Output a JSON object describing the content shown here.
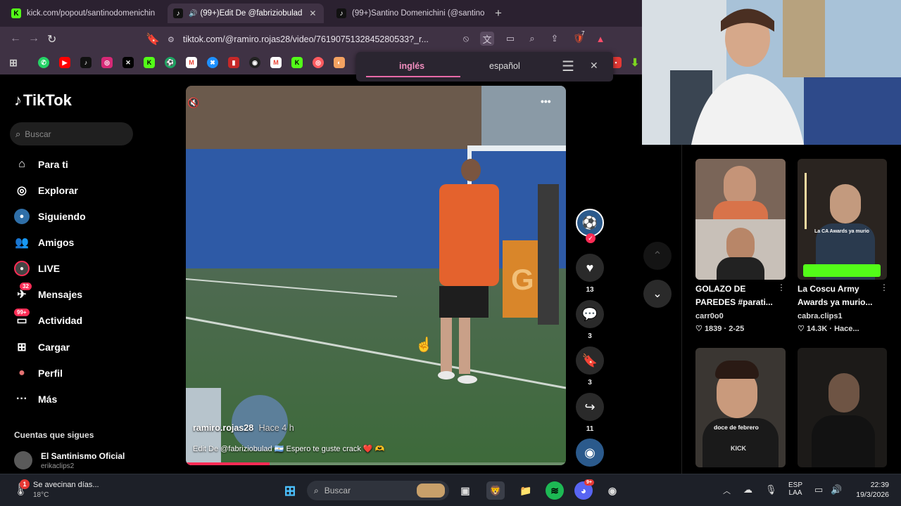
{
  "browser": {
    "tabs": [
      {
        "label": "kick.com/popout/santinodomenichin",
        "favicon": "K"
      },
      {
        "label": "(99+)Edit De @fabriziobulad",
        "favicon": "tiktok-icon"
      },
      {
        "label": "(99+)Santino Domenichini (@santino",
        "favicon": "tiktok-icon"
      }
    ],
    "new_tab_label": "+",
    "url": "tiktok.com/@ramiro.rojas28/video/7619075132845280533?_r...",
    "shield_count": "7"
  },
  "translate_popup": {
    "lang_active": "inglés",
    "lang_other": "español"
  },
  "tiktok": {
    "logo": "TikTok",
    "search_placeholder": "Buscar",
    "nav": [
      {
        "label": "Para ti",
        "icon": "home-icon"
      },
      {
        "label": "Explorar",
        "icon": "compass-icon"
      },
      {
        "label": "Siguiendo",
        "icon": "following-avatar-icon"
      },
      {
        "label": "Amigos",
        "icon": "friends-icon"
      },
      {
        "label": "LIVE",
        "icon": "live-icon"
      },
      {
        "label": "Mensajes",
        "icon": "messages-icon",
        "badge": "32"
      },
      {
        "label": "Actividad",
        "icon": "activity-icon",
        "badge": "99+"
      },
      {
        "label": "Cargar",
        "icon": "upload-icon"
      },
      {
        "label": "Perfil",
        "icon": "profile-icon"
      },
      {
        "label": "Más",
        "icon": "more-icon"
      }
    ],
    "following_header": "Cuentas que sigues",
    "following_accounts": [
      {
        "name": "El Santinismo Oficial",
        "handle": "erikaclips2"
      }
    ]
  },
  "video": {
    "author": "ramiro.rojas28",
    "time_ago": "Hace 4 h",
    "caption": "Edit De @fabriziobulad 🇦🇷 Espero te guste crack ❤️ 🫶",
    "progress": 0.22,
    "more_label": "•••"
  },
  "actions": {
    "likes": "13",
    "comments": "3",
    "saves": "3",
    "shares": "11"
  },
  "recommended": [
    {
      "title_line1": "GOLAZO DE",
      "title_line2": "PAREDES #parati...",
      "author": "carr0o0",
      "likes": "1839",
      "date": "2-25"
    },
    {
      "title_line1": "La Coscu Army",
      "title_line2": "Awards ya murio...",
      "author": "cabra.clips1",
      "likes": "14.3K",
      "date": "Hace..."
    },
    {
      "overlay_text": "doce de febrero"
    },
    {
      "overlay_text": ""
    }
  ],
  "thumb_texts": {
    "coscu_overlay": "La CA Awards ya murio",
    "kick_overlay": "KICK"
  },
  "taskbar": {
    "weather_title": "Se avecinan días...",
    "weather_temp": "18°C",
    "weather_badge": "1",
    "search_label": "Buscar",
    "lang_top": "ESP",
    "lang_bottom": "LAA",
    "time": "22:39",
    "date": "19/3/2026",
    "discord_badge": "9+"
  },
  "colors": {
    "tiktok_pink": "#fe2c55",
    "chrome_bg": "#3f3244",
    "taskbar_bg": "#1d2028",
    "accent_underline": "#e86aa8"
  }
}
